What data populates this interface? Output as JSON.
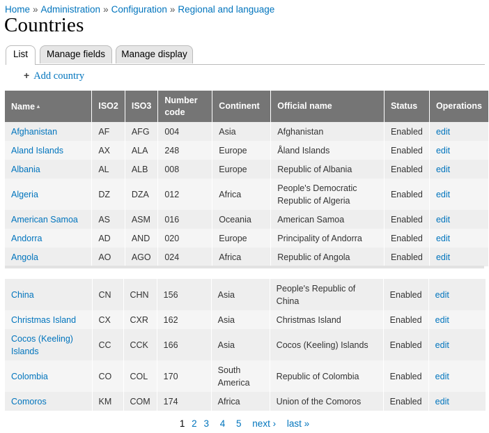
{
  "breadcrumb": [
    "Home",
    "Administration",
    "Configuration",
    "Regional and language"
  ],
  "breadcrumb_separator": "»",
  "title": "Countries",
  "tabs": [
    {
      "label": "List",
      "active": true
    },
    {
      "label": "Manage fields",
      "active": false
    },
    {
      "label": "Manage display",
      "active": false
    }
  ],
  "add_country": {
    "icon": "plus-icon",
    "label": "Add country"
  },
  "table": {
    "headers": {
      "name": "Name",
      "iso2": "ISO2",
      "iso3": "ISO3",
      "number": "Number code",
      "continent": "Continent",
      "official": "Official name",
      "status": "Status",
      "operations": "Operations"
    },
    "sort_icon": "sort-asc-icon",
    "rows_top": [
      {
        "name": "Afghanistan",
        "iso2": "AF",
        "iso3": "AFG",
        "number": "004",
        "continent": "Asia",
        "official": "Afghanistan",
        "status": "Enabled",
        "op": "edit"
      },
      {
        "name": "Aland Islands",
        "iso2": "AX",
        "iso3": "ALA",
        "number": "248",
        "continent": "Europe",
        "official": "Åland Islands",
        "status": "Enabled",
        "op": "edit"
      },
      {
        "name": "Albania",
        "iso2": "AL",
        "iso3": "ALB",
        "number": "008",
        "continent": "Europe",
        "official": "Republic of Albania",
        "status": "Enabled",
        "op": "edit"
      },
      {
        "name": "Algeria",
        "iso2": "DZ",
        "iso3": "DZA",
        "number": "012",
        "continent": "Africa",
        "official": "People's Democratic Republic of Algeria",
        "status": "Enabled",
        "op": "edit"
      },
      {
        "name": "American Samoa",
        "iso2": "AS",
        "iso3": "ASM",
        "number": "016",
        "continent": "Oceania",
        "official": "American Samoa",
        "status": "Enabled",
        "op": "edit"
      },
      {
        "name": "Andorra",
        "iso2": "AD",
        "iso3": "AND",
        "number": "020",
        "continent": "Europe",
        "official": "Principality of Andorra",
        "status": "Enabled",
        "op": "edit"
      },
      {
        "name": "Angola",
        "iso2": "AO",
        "iso3": "AGO",
        "number": "024",
        "continent": "Africa",
        "official": "Republic of Angola",
        "status": "Enabled",
        "op": "edit"
      }
    ],
    "rows_bottom": [
      {
        "name": "China",
        "iso2": "CN",
        "iso3": "CHN",
        "number": "156",
        "continent": "Asia",
        "official": "People's Republic of China",
        "status": "Enabled",
        "op": "edit"
      },
      {
        "name": "Christmas Island",
        "iso2": "CX",
        "iso3": "CXR",
        "number": "162",
        "continent": "Asia",
        "official": "Christmas Island",
        "status": "Enabled",
        "op": "edit"
      },
      {
        "name": "Cocos (Keeling) Islands",
        "iso2": "CC",
        "iso3": "CCK",
        "number": "166",
        "continent": "Asia",
        "official": "Cocos (Keeling) Islands",
        "status": "Enabled",
        "op": "edit"
      },
      {
        "name": "Colombia",
        "iso2": "CO",
        "iso3": "COL",
        "number": "170",
        "continent": "South America",
        "official": "Republic of Colombia",
        "status": "Enabled",
        "op": "edit"
      },
      {
        "name": "Comoros",
        "iso2": "KM",
        "iso3": "COM",
        "number": "174",
        "continent": "Africa",
        "official": "Union of the Comoros",
        "status": "Enabled",
        "op": "edit"
      }
    ]
  },
  "pager": {
    "pages": [
      "1",
      "2",
      "3",
      "4",
      "5"
    ],
    "current": "1",
    "next": "next ›",
    "last": "last »"
  },
  "colors": {
    "link": "#0074bd",
    "header_bg": "#757575",
    "row_odd": "#eeeeee",
    "row_even": "#f5f5f5"
  }
}
